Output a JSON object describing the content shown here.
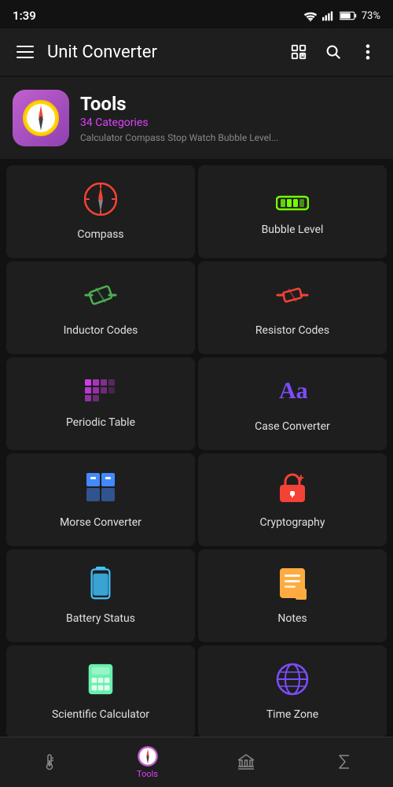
{
  "statusBar": {
    "time": "1:39",
    "battery": "73%",
    "batteryIcon": "🔋"
  },
  "appBar": {
    "title": "Unit Converter",
    "menuIcon": "☰",
    "gridStarIcon": "⊞",
    "searchIcon": "🔍",
    "moreIcon": "⋮"
  },
  "header": {
    "title": "Tools",
    "subtitle": "34 Categories",
    "description": "Calculator Compass Stop Watch Bubble Level...",
    "iconEmoji": "🧭"
  },
  "grid": {
    "items": [
      {
        "id": "compass",
        "label": "Compass",
        "color": "#f44336",
        "iconType": "compass"
      },
      {
        "id": "bubble-level",
        "label": "Bubble Level",
        "color": "#76ff03",
        "iconType": "bubble"
      },
      {
        "id": "inductor-codes",
        "label": "Inductor Codes",
        "color": "#4caf50",
        "iconType": "inductor"
      },
      {
        "id": "resistor-codes",
        "label": "Resistor Codes",
        "color": "#f44336",
        "iconType": "resistor"
      },
      {
        "id": "periodic-table",
        "label": "Periodic Table",
        "color": "#e040fb",
        "iconType": "periodic"
      },
      {
        "id": "case-converter",
        "label": "Case Converter",
        "color": "#7c4dff",
        "iconType": "text"
      },
      {
        "id": "morse-converter",
        "label": "Morse Converter",
        "color": "#448aff",
        "iconType": "morse"
      },
      {
        "id": "cryptography",
        "label": "Cryptography",
        "color": "#f44336",
        "iconType": "lock"
      },
      {
        "id": "battery-status",
        "label": "Battery Status",
        "color": "#40c4ff",
        "iconType": "battery"
      },
      {
        "id": "notes",
        "label": "Notes",
        "color": "#ffab40",
        "iconType": "notes"
      },
      {
        "id": "scientific-calculator",
        "label": "Scientific Calculator",
        "color": "#69f0ae",
        "iconType": "calc"
      },
      {
        "id": "time-zone",
        "label": "Time Zone",
        "color": "#7c4dff",
        "iconType": "globe"
      }
    ]
  },
  "bottomNav": {
    "items": [
      {
        "id": "thermometer",
        "label": "",
        "active": false,
        "iconType": "thermo"
      },
      {
        "id": "tools",
        "label": "Tools",
        "active": true,
        "iconType": "compass"
      },
      {
        "id": "library",
        "label": "",
        "active": false,
        "iconType": "bank"
      },
      {
        "id": "sigma",
        "label": "",
        "active": false,
        "iconType": "sigma"
      }
    ]
  }
}
